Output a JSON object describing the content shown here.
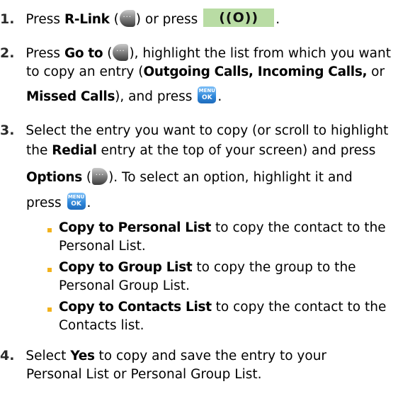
{
  "steps": [
    {
      "number": "1.",
      "press": "Press",
      "rlink": "R-Link",
      "paren_open": "(",
      "or_press": ") or press",
      "end": "."
    },
    {
      "number": "2.",
      "press": "Press",
      "goto": "Go to",
      "paren_open": "(",
      "rest1": "), highlight the list from which you want",
      "line2_a": "to copy an entry (",
      "outgoing": "Outgoing Calls, Incoming Calls,",
      "or": " or",
      "missed": "Missed Calls",
      "and_press": "), and press",
      "end": "."
    },
    {
      "number": "3.",
      "line1": "Select the entry you want to copy (or scroll to highlight",
      "line2_a": "the",
      "redial": "Redial",
      "line2_b": " entry at the top of your screen) and press",
      "options": "Options",
      "paren_open": " (",
      "line3_b": "). To select an option, highlight it and",
      "press": "press",
      "end": "."
    },
    {
      "number": "4.",
      "line1_a": "Select",
      "yes": "Yes",
      "line1_b": " to copy and save the entry to your",
      "line2": "Personal List or Personal Group List."
    }
  ],
  "bullets": [
    {
      "label": "Copy to Personal List",
      "text1": " to copy the contact to the",
      "text2": "Personal List."
    },
    {
      "label": "Copy to Group List",
      "text1": " to copy the group to the",
      "text2": "Personal Group List."
    },
    {
      "label": "Copy to Contacts List",
      "text1": " to copy the contact to the",
      "text2": "Contacts list."
    }
  ],
  "keys": {
    "talk_symbol": "((O))",
    "menu_top": "MENU",
    "menu_bottom": "OK",
    "softkey_glyph": "···"
  },
  "colors": {
    "bullet": "#f2b21c",
    "talk_key": "#b9dca4",
    "menu_key": "#2e86d9"
  }
}
